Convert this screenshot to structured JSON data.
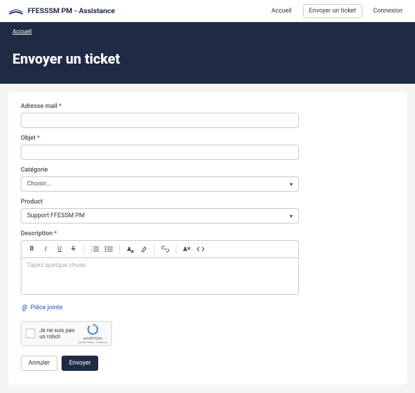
{
  "brand": {
    "title": "FFESSSM PM - Assistance"
  },
  "nav": {
    "home": "Accueil",
    "submit": "Envoyer un ticket",
    "login": "Connexion"
  },
  "breadcrumb": "Accueil",
  "hero_title": "Envoyer un ticket",
  "form": {
    "email_label": "Adresse mail",
    "subject_label": "Objet",
    "category_label": "Catégorie",
    "category_value": "Choisir...",
    "product_label": "Product",
    "product_value": "Support FFESSM PM",
    "description_label": "Description",
    "editor_placeholder": "Tapez quelque chose",
    "attachment": "Pièce jointe",
    "recaptcha_text": "Je ne suis pas un robot",
    "recaptcha_brand": "reCAPTCHA",
    "recaptcha_sub": "Confidentialité - Conditions",
    "cancel": "Annuler",
    "submit": "Envoyer",
    "asterisk": "*"
  }
}
